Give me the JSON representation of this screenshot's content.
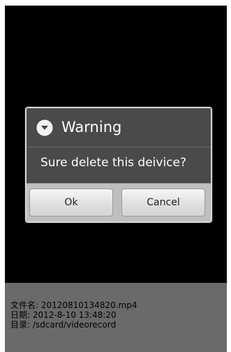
{
  "dialog": {
    "title": "Warning",
    "message": "Sure delete this deivice?",
    "icon": "warning-chevron-down-icon"
  },
  "buttons": {
    "ok_label": "Ok",
    "cancel_label": "Cancel"
  },
  "file_info": {
    "filename": "文件名: 20120810134820.mp4",
    "date": "日期: 2012-8-10 13:48:20",
    "directory": "目录: /sdcard/videorecord"
  },
  "colors": {
    "screen_background": "#000000",
    "dialog_background": "#4a4a4a",
    "button_bar": "#bfbfbf",
    "info_panel": "#6a6a6a"
  }
}
